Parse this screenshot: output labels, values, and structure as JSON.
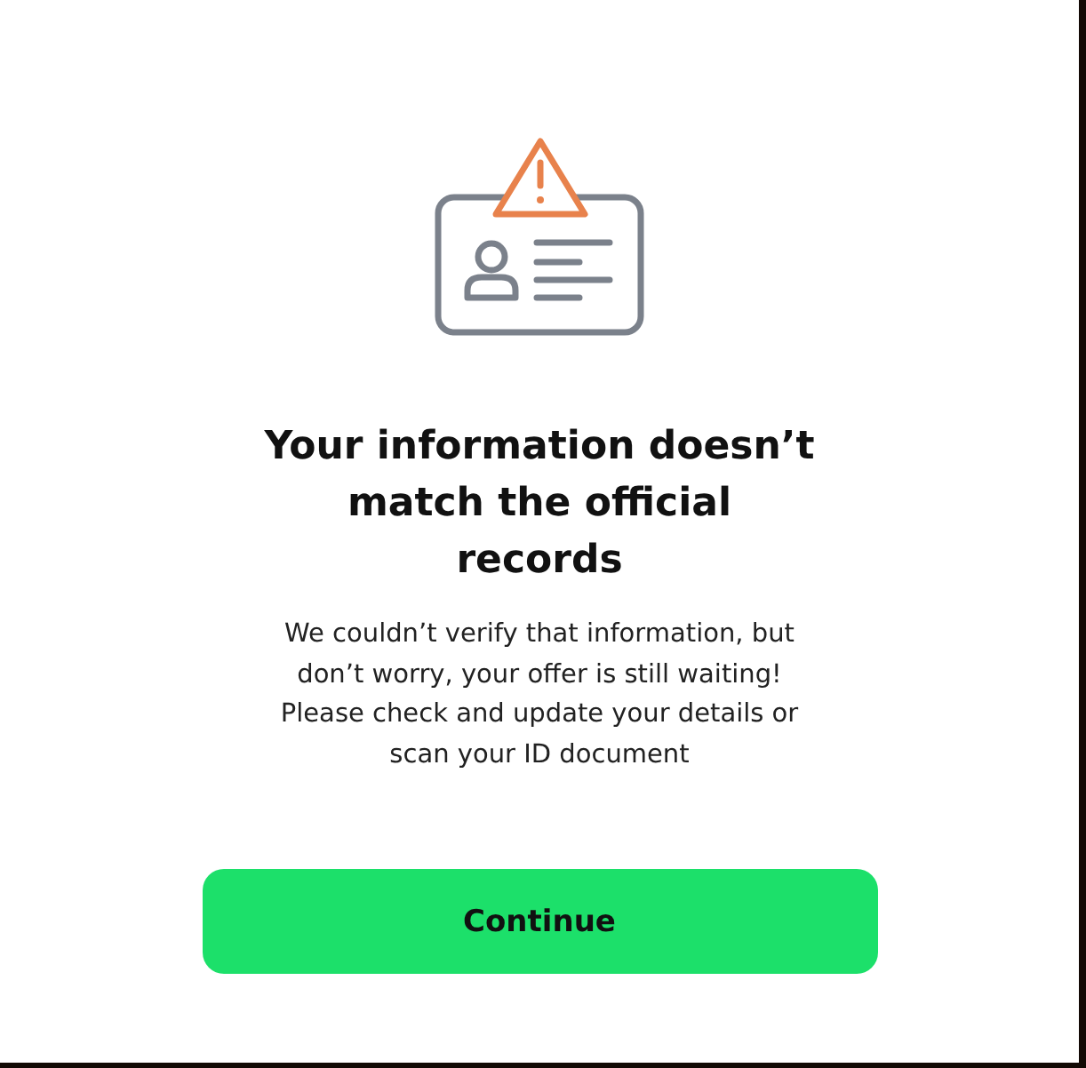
{
  "heading": "Your information doesn’t match the official records",
  "message": "We couldn’t verify that information, but don’t worry, your offer is still waiting! Please check and update your details or scan your ID document",
  "button": {
    "label": "Continue"
  }
}
